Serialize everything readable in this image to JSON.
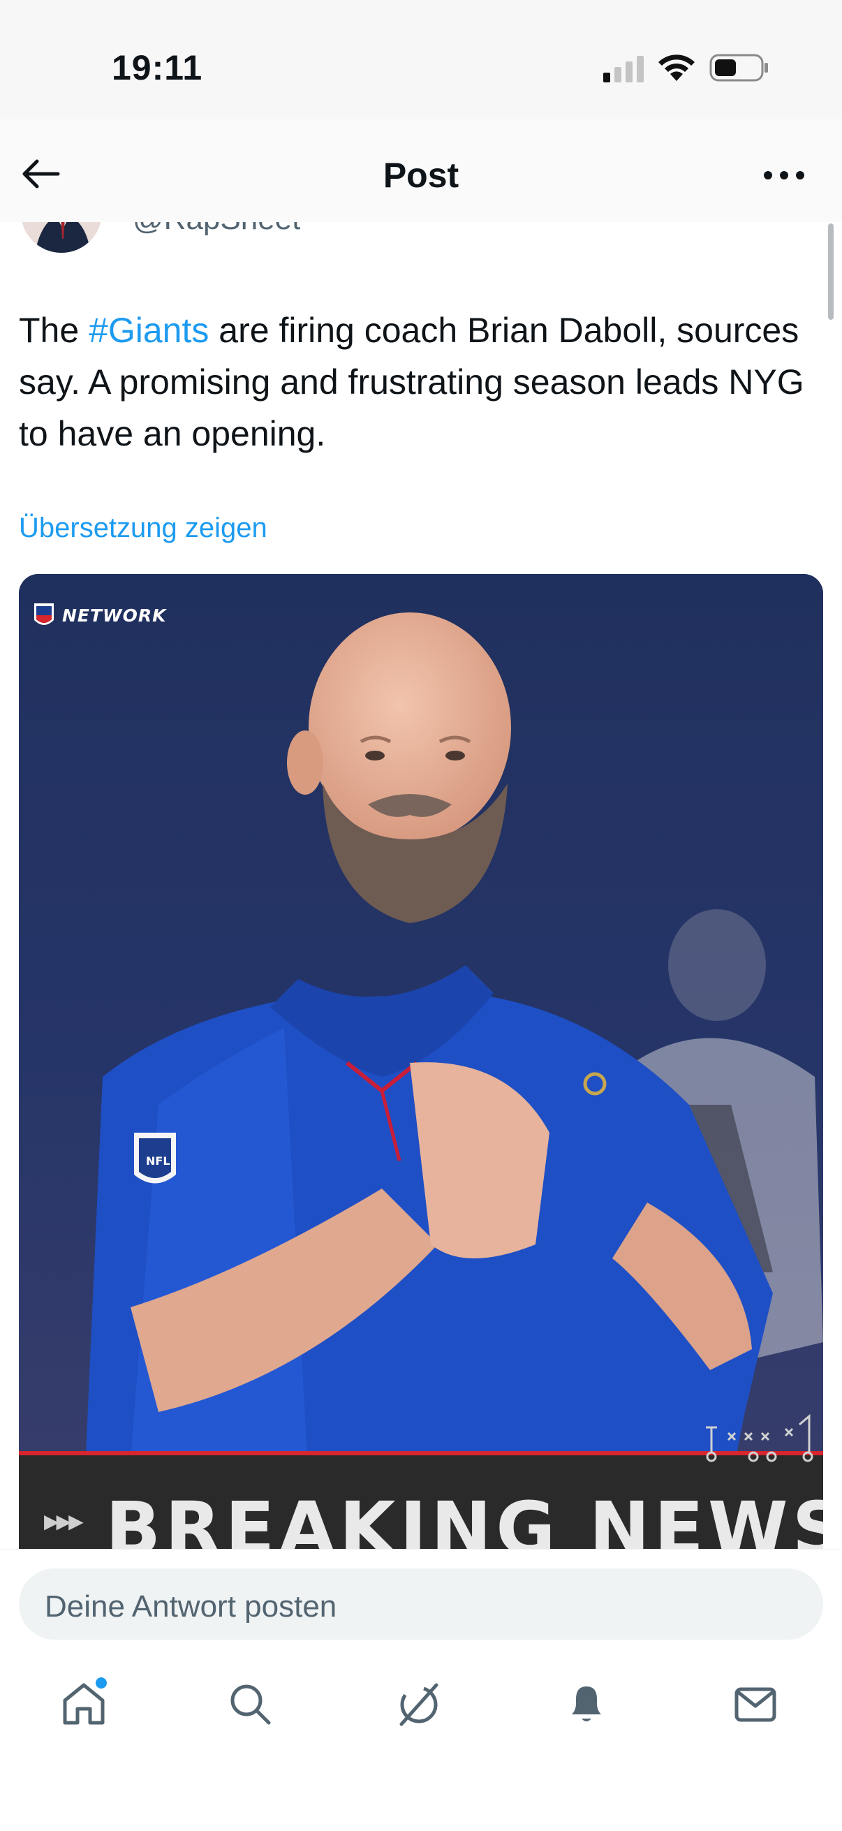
{
  "status_bar": {
    "time": "19:11"
  },
  "header": {
    "title": "Post"
  },
  "author": {
    "handle": "@RapSheet"
  },
  "tweet": {
    "text_before": "The ",
    "hashtag": "#Giants",
    "text_after": " are firing coach Brian Daboll, sources say. A promising and frustrating season leads NYG to have an opening.",
    "translate_label": "Übersetzung zeigen"
  },
  "media": {
    "network_label": "NETWORK",
    "banner_text": "BREAKING NEWS",
    "banner_arrows": "▶▶▶"
  },
  "reply": {
    "placeholder": "Deine Antwort posten"
  },
  "colors": {
    "accent": "#1d9bf0",
    "banner_red": "#d7262e",
    "text": "#0f1419",
    "muted": "#536471"
  },
  "tabs": [
    {
      "icon": "home-icon",
      "has_dot": true
    },
    {
      "icon": "search-icon"
    },
    {
      "icon": "grok-icon"
    },
    {
      "icon": "bell-icon"
    },
    {
      "icon": "mail-icon"
    }
  ]
}
